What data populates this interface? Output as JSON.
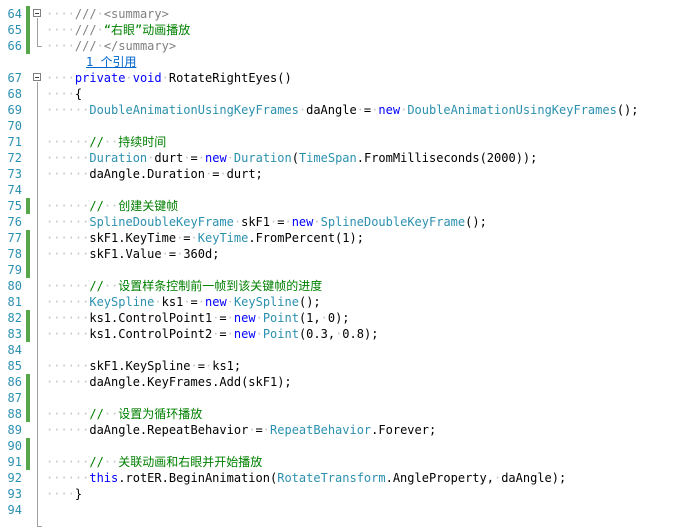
{
  "editor": {
    "reference_link": "1 个引用",
    "lines": [
      {
        "num": "64",
        "fold": "open",
        "mod": true,
        "tokens": [
          [
            "ws",
            "····"
          ],
          [
            "x",
            "///"
          ],
          [
            "ws",
            "·"
          ],
          [
            "x",
            "<summary>"
          ]
        ]
      },
      {
        "num": "65",
        "fold": "",
        "mod": true,
        "tokens": [
          [
            "ws",
            "····"
          ],
          [
            "x",
            "///"
          ],
          [
            "ws",
            "·"
          ],
          [
            "c",
            "“右眼”动画播放"
          ]
        ]
      },
      {
        "num": "66",
        "fold": "",
        "mod": true,
        "tokens": [
          [
            "ws",
            "····"
          ],
          [
            "x",
            "///"
          ],
          [
            "ws",
            "·"
          ],
          [
            "x",
            "</summary>"
          ]
        ]
      },
      {
        "num": "",
        "fold": "",
        "mod": false,
        "codelens": true,
        "tokens": []
      },
      {
        "num": "67",
        "fold": "open",
        "mod": false,
        "tokens": [
          [
            "ws",
            "····"
          ],
          [
            "k",
            "private"
          ],
          [
            "ws",
            "·"
          ],
          [
            "k",
            "void"
          ],
          [
            "ws",
            "·"
          ],
          [
            "p",
            "RotateRightEyes()"
          ]
        ]
      },
      {
        "num": "68",
        "fold": "",
        "mod": false,
        "tokens": [
          [
            "ws",
            "····"
          ],
          [
            "p",
            "{"
          ]
        ]
      },
      {
        "num": "69",
        "fold": "",
        "mod": false,
        "tokens": [
          [
            "ws",
            "······"
          ],
          [
            "t",
            "DoubleAnimationUsingKeyFrames"
          ],
          [
            "ws",
            "·"
          ],
          [
            "p",
            "daAngle"
          ],
          [
            "ws",
            "·"
          ],
          [
            "p",
            "="
          ],
          [
            "ws",
            "·"
          ],
          [
            "k",
            "new"
          ],
          [
            "ws",
            "·"
          ],
          [
            "t",
            "DoubleAnimationUsingKeyFrames"
          ],
          [
            "p",
            "();"
          ]
        ]
      },
      {
        "num": "70",
        "fold": "",
        "mod": false,
        "tokens": []
      },
      {
        "num": "71",
        "fold": "",
        "mod": false,
        "tokens": [
          [
            "ws",
            "······"
          ],
          [
            "c",
            "//"
          ],
          [
            "ws",
            "··"
          ],
          [
            "c",
            "持续时间"
          ]
        ]
      },
      {
        "num": "72",
        "fold": "",
        "mod": false,
        "tokens": [
          [
            "ws",
            "······"
          ],
          [
            "t",
            "Duration"
          ],
          [
            "ws",
            "·"
          ],
          [
            "p",
            "durt"
          ],
          [
            "ws",
            "·"
          ],
          [
            "p",
            "="
          ],
          [
            "ws",
            "·"
          ],
          [
            "k",
            "new"
          ],
          [
            "ws",
            "·"
          ],
          [
            "t",
            "Duration"
          ],
          [
            "p",
            "("
          ],
          [
            "t",
            "TimeSpan"
          ],
          [
            "p",
            ".FromMilliseconds(2000));"
          ]
        ]
      },
      {
        "num": "73",
        "fold": "",
        "mod": false,
        "tokens": [
          [
            "ws",
            "······"
          ],
          [
            "p",
            "daAngle.Duration"
          ],
          [
            "ws",
            "·"
          ],
          [
            "p",
            "="
          ],
          [
            "ws",
            "·"
          ],
          [
            "p",
            "durt;"
          ]
        ]
      },
      {
        "num": "74",
        "fold": "",
        "mod": false,
        "tokens": []
      },
      {
        "num": "75",
        "fold": "",
        "mod": true,
        "tokens": [
          [
            "ws",
            "······"
          ],
          [
            "c",
            "//"
          ],
          [
            "ws",
            "··"
          ],
          [
            "c",
            "创建关键帧"
          ]
        ]
      },
      {
        "num": "76",
        "fold": "",
        "mod": false,
        "tokens": [
          [
            "ws",
            "······"
          ],
          [
            "t",
            "SplineDoubleKeyFrame"
          ],
          [
            "ws",
            "·"
          ],
          [
            "p",
            "skF1"
          ],
          [
            "ws",
            "·"
          ],
          [
            "p",
            "="
          ],
          [
            "ws",
            "·"
          ],
          [
            "k",
            "new"
          ],
          [
            "ws",
            "·"
          ],
          [
            "t",
            "SplineDoubleKeyFrame"
          ],
          [
            "p",
            "();"
          ]
        ]
      },
      {
        "num": "77",
        "fold": "",
        "mod": true,
        "tokens": [
          [
            "ws",
            "······"
          ],
          [
            "p",
            "skF1.KeyTime"
          ],
          [
            "ws",
            "·"
          ],
          [
            "p",
            "="
          ],
          [
            "ws",
            "·"
          ],
          [
            "t",
            "KeyTime"
          ],
          [
            "p",
            ".FromPercent(1);"
          ]
        ]
      },
      {
        "num": "78",
        "fold": "",
        "mod": true,
        "tokens": [
          [
            "ws",
            "······"
          ],
          [
            "p",
            "skF1.Value"
          ],
          [
            "ws",
            "·"
          ],
          [
            "p",
            "="
          ],
          [
            "ws",
            "·"
          ],
          [
            "p",
            "360d;"
          ]
        ]
      },
      {
        "num": "79",
        "fold": "",
        "mod": true,
        "tokens": []
      },
      {
        "num": "80",
        "fold": "",
        "mod": false,
        "tokens": [
          [
            "ws",
            "······"
          ],
          [
            "c",
            "//"
          ],
          [
            "ws",
            "··"
          ],
          [
            "c",
            "设置样条控制前一帧到该关键帧的进度"
          ]
        ]
      },
      {
        "num": "81",
        "fold": "",
        "mod": false,
        "tokens": [
          [
            "ws",
            "······"
          ],
          [
            "t",
            "KeySpline"
          ],
          [
            "ws",
            "·"
          ],
          [
            "p",
            "ks1"
          ],
          [
            "ws",
            "·"
          ],
          [
            "p",
            "="
          ],
          [
            "ws",
            "·"
          ],
          [
            "k",
            "new"
          ],
          [
            "ws",
            "·"
          ],
          [
            "t",
            "KeySpline"
          ],
          [
            "p",
            "();"
          ]
        ]
      },
      {
        "num": "82",
        "fold": "",
        "mod": true,
        "tokens": [
          [
            "ws",
            "······"
          ],
          [
            "p",
            "ks1.ControlPoint1"
          ],
          [
            "ws",
            "·"
          ],
          [
            "p",
            "="
          ],
          [
            "ws",
            "·"
          ],
          [
            "k",
            "new"
          ],
          [
            "ws",
            "·"
          ],
          [
            "t",
            "Point"
          ],
          [
            "p",
            "(1,"
          ],
          [
            "ws",
            "·"
          ],
          [
            "p",
            "0);"
          ]
        ]
      },
      {
        "num": "83",
        "fold": "",
        "mod": true,
        "tokens": [
          [
            "ws",
            "······"
          ],
          [
            "p",
            "ks1.ControlPoint2"
          ],
          [
            "ws",
            "·"
          ],
          [
            "p",
            "="
          ],
          [
            "ws",
            "·"
          ],
          [
            "k",
            "new"
          ],
          [
            "ws",
            "·"
          ],
          [
            "t",
            "Point"
          ],
          [
            "p",
            "(0.3,"
          ],
          [
            "ws",
            "·"
          ],
          [
            "p",
            "0.8);"
          ]
        ]
      },
      {
        "num": "84",
        "fold": "",
        "mod": false,
        "tokens": []
      },
      {
        "num": "85",
        "fold": "",
        "mod": false,
        "tokens": [
          [
            "ws",
            "······"
          ],
          [
            "p",
            "skF1.KeySpline"
          ],
          [
            "ws",
            "·"
          ],
          [
            "p",
            "="
          ],
          [
            "ws",
            "·"
          ],
          [
            "p",
            "ks1;"
          ]
        ]
      },
      {
        "num": "86",
        "fold": "",
        "mod": true,
        "tokens": [
          [
            "ws",
            "······"
          ],
          [
            "p",
            "daAngle.KeyFrames.Add(skF1);"
          ]
        ]
      },
      {
        "num": "87",
        "fold": "",
        "mod": true,
        "tokens": []
      },
      {
        "num": "88",
        "fold": "",
        "mod": true,
        "tokens": [
          [
            "ws",
            "······"
          ],
          [
            "c",
            "//"
          ],
          [
            "ws",
            "··"
          ],
          [
            "c",
            "设置为循环播放"
          ]
        ]
      },
      {
        "num": "89",
        "fold": "",
        "mod": false,
        "tokens": [
          [
            "ws",
            "······"
          ],
          [
            "p",
            "daAngle.RepeatBehavior"
          ],
          [
            "ws",
            "·"
          ],
          [
            "p",
            "="
          ],
          [
            "ws",
            "·"
          ],
          [
            "t",
            "RepeatBehavior"
          ],
          [
            "p",
            ".Forever;"
          ]
        ]
      },
      {
        "num": "90",
        "fold": "",
        "mod": true,
        "tokens": []
      },
      {
        "num": "91",
        "fold": "",
        "mod": true,
        "tokens": [
          [
            "ws",
            "······"
          ],
          [
            "c",
            "//"
          ],
          [
            "ws",
            "··"
          ],
          [
            "c",
            "关联动画和右眼并开始播放"
          ]
        ]
      },
      {
        "num": "92",
        "fold": "",
        "mod": false,
        "tokens": [
          [
            "ws",
            "······"
          ],
          [
            "k",
            "this"
          ],
          [
            "p",
            ".rotER.BeginAnimation("
          ],
          [
            "t",
            "RotateTransform"
          ],
          [
            "p",
            ".AngleProperty,"
          ],
          [
            "ws",
            "·"
          ],
          [
            "p",
            "daAngle);"
          ]
        ]
      },
      {
        "num": "93",
        "fold": "",
        "mod": false,
        "tokens": [
          [
            "ws",
            "····"
          ],
          [
            "p",
            "}"
          ]
        ]
      },
      {
        "num": "94",
        "fold": "",
        "mod": false,
        "tokens": []
      }
    ]
  }
}
